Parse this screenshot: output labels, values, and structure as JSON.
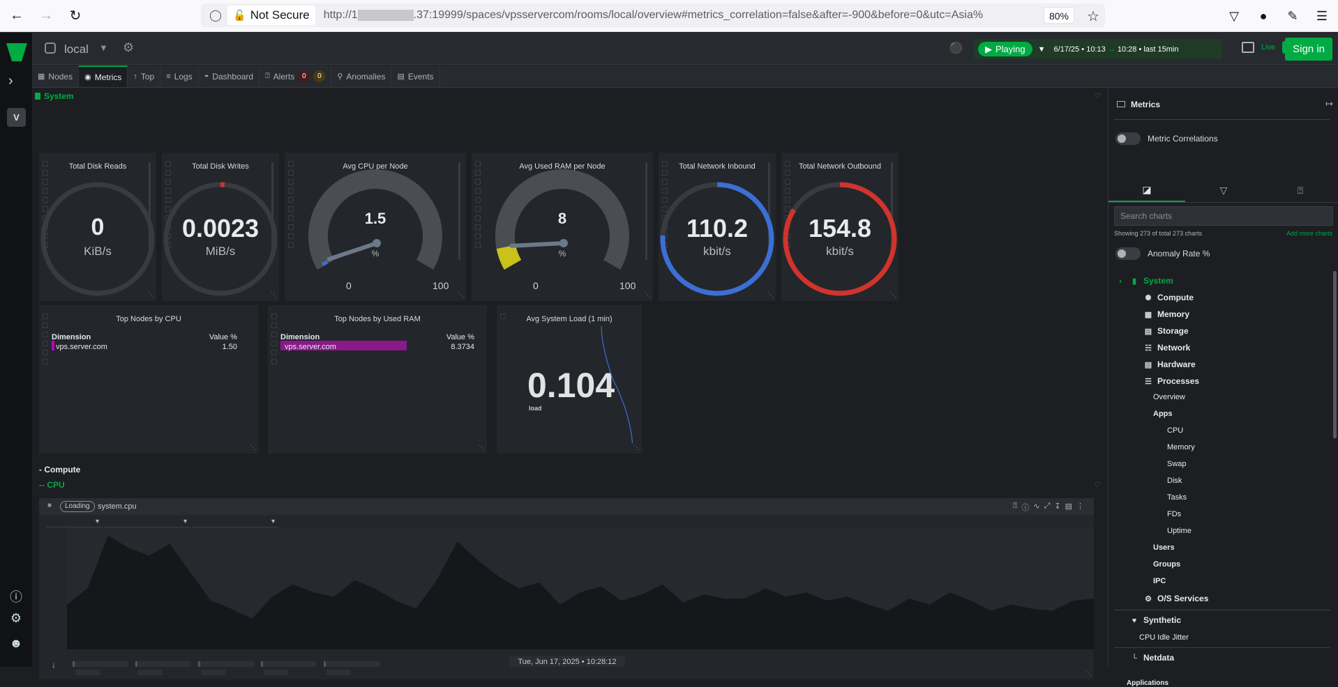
{
  "browser": {
    "not_secure_label": "Not Secure",
    "url_prefix": "http://1",
    "url_suffix": ".37:19999/spaces/vpsservercom/rooms/local/overview#metrics_correlation=false&after=-900&before=0&utc=Asia%",
    "zoom": "80%"
  },
  "topbar": {
    "room_name": "local",
    "playing_label": "Playing",
    "time_start": "6/17/25 • 10:13",
    "time_end": "10:28",
    "time_last": "• last 15min",
    "live_label": "Live",
    "live_count": "1",
    "sign_in": "Sign in"
  },
  "rail": {
    "space_initial": "V"
  },
  "tabs": [
    {
      "label": "Nodes"
    },
    {
      "label": "Metrics"
    },
    {
      "label": "Top"
    },
    {
      "label": "Logs"
    },
    {
      "label": "Dashboard"
    },
    {
      "label": "Alerts"
    },
    {
      "label": "Anomalies"
    },
    {
      "label": "Events"
    }
  ],
  "alerts": {
    "critical": "0",
    "warning": "0"
  },
  "sections": {
    "system": "System",
    "compute": "- Compute",
    "cpu": "-- CPU"
  },
  "gauges": [
    {
      "title": "Total Disk Reads",
      "value": "0",
      "unit": "KiB/s",
      "fraction": 0,
      "color": "#d0342c"
    },
    {
      "title": "Total Disk Writes",
      "value": "0.0023",
      "unit": "MiB/s",
      "fraction": 0.01,
      "color": "#d0342c"
    },
    {
      "title": "Avg CPU per Node",
      "value": "1.5",
      "unit": "%",
      "min": "0",
      "max": "100",
      "fraction": 0.015,
      "color": "#3b6fd4"
    },
    {
      "title": "Avg Used RAM per Node",
      "value": "8",
      "unit": "%",
      "min": "0",
      "max": "100",
      "fraction": 0.08,
      "color": "#c8c21a"
    },
    {
      "title": "Total Network Inbound",
      "value": "110.2",
      "unit": "kbit/s",
      "fraction": 0.76,
      "color": "#3b6fd4"
    },
    {
      "title": "Total Network Outbound",
      "value": "154.8",
      "unit": "kbit/s",
      "fraction": 0.84,
      "color": "#d0342c"
    }
  ],
  "top_cpu": {
    "title": "Top Nodes by CPU",
    "col1": "Dimension",
    "col2": "Value %",
    "row_name": "vps.server.com",
    "row_value": "1.50",
    "bar_fraction": 0.015,
    "bar_color": "#c000c0"
  },
  "top_ram": {
    "title": "Top Nodes by Used RAM",
    "col1": "Dimension",
    "col2": "Value %",
    "row_name": "vps.server.com",
    "row_value": "8.3734",
    "bar_fraction": 0.084,
    "bar_color": "#8a1a8a"
  },
  "load": {
    "title": "Avg System Load (1 min)",
    "value": "0.104",
    "unit": "load"
  },
  "cpu_chart": {
    "loading": "Loading",
    "context": "system.cpu"
  },
  "chart_data": {
    "type": "area",
    "title": "system.cpu",
    "x": [
      0,
      1,
      2,
      3,
      4,
      5,
      6,
      7,
      8,
      9,
      10,
      11,
      12,
      13,
      14,
      15,
      16,
      17,
      18,
      19,
      20,
      21,
      22,
      23,
      24,
      25,
      26,
      27,
      28,
      29,
      30,
      31,
      32,
      33,
      34,
      35,
      36,
      37,
      38,
      39,
      40,
      41,
      42,
      43,
      44,
      45,
      46,
      47,
      48,
      49,
      50
    ],
    "values": [
      2.2,
      3.0,
      5.6,
      5.0,
      4.6,
      5.2,
      3.8,
      2.4,
      2.0,
      1.5,
      2.6,
      3.2,
      2.8,
      2.6,
      3.4,
      3.0,
      2.4,
      2.0,
      3.4,
      5.3,
      4.4,
      3.6,
      3.0,
      3.3,
      2.2,
      2.8,
      3.1,
      2.4,
      2.7,
      3.2,
      2.3,
      2.7,
      2.5,
      2.5,
      3.0,
      2.6,
      2.8,
      2.4,
      2.6,
      2.2,
      1.9,
      2.5,
      2.2,
      2.8,
      2.4,
      1.9,
      2.2,
      2.0,
      1.9,
      2.4,
      2.5
    ],
    "ylim": [
      0,
      6
    ]
  },
  "load_data": {
    "type": "line",
    "values": [
      1.0,
      0.99,
      0.97,
      0.94,
      0.9,
      0.85,
      0.8,
      0.74,
      0.68,
      0.6,
      0.5,
      0.42,
      0.34,
      0.26,
      0.2,
      0.15,
      0.1,
      0.06,
      0.03,
      0.01
    ]
  },
  "right_panel": {
    "title": "Metrics",
    "metric_correlations": "Metric Correlations",
    "search_placeholder": "Search charts",
    "showing": "Showing 273 of total 273 charts",
    "add_more": "Add more charts",
    "anomaly_rate": "Anomaly Rate %",
    "tree": {
      "system": "System",
      "compute": "Compute",
      "memory": "Memory",
      "storage": "Storage",
      "network": "Network",
      "hardware": "Hardware",
      "processes": "Processes",
      "overview": "Overview",
      "apps": "Apps",
      "apps_cpu": "CPU",
      "apps_memory": "Memory",
      "apps_swap": "Swap",
      "apps_disk": "Disk",
      "apps_tasks": "Tasks",
      "apps_fds": "FDs",
      "apps_uptime": "Uptime",
      "users": "Users",
      "groups": "Groups",
      "ipc": "IPC",
      "os_services": "O/S Services",
      "synthetic": "Synthetic",
      "cpu_idle_jitter": "CPU Idle Jitter",
      "netdata": "Netdata",
      "applications": "Applications"
    }
  },
  "datebar": "Tue, Jun 17, 2025 • 10:28:12",
  "colors": {
    "accent": "#00ab44",
    "background": "#1c1e22",
    "panel": "#23262b"
  }
}
